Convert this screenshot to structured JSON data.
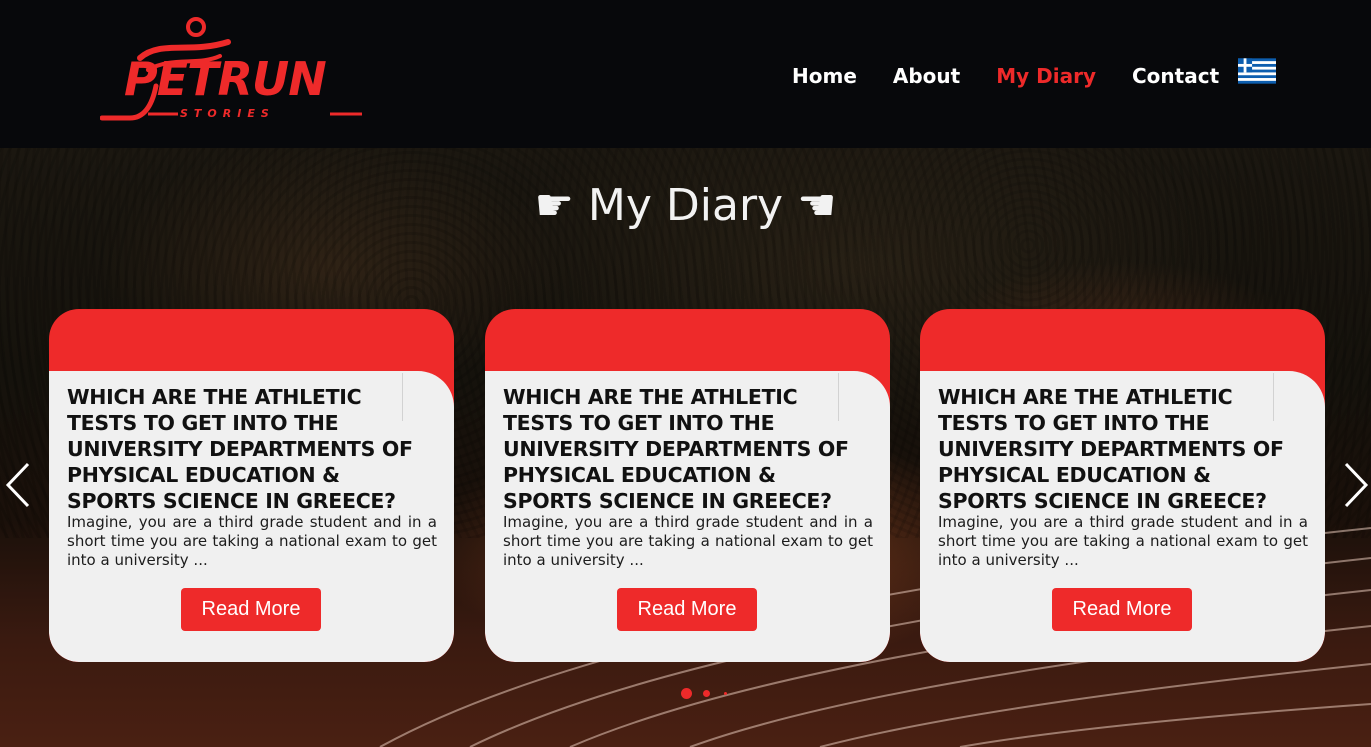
{
  "brand": {
    "name": "PETRUN",
    "tagline": "STORIES"
  },
  "nav": {
    "items": [
      {
        "label": "Home",
        "active": false
      },
      {
        "label": "About",
        "active": false
      },
      {
        "label": "My Diary",
        "active": true
      },
      {
        "label": "Contact",
        "active": false
      }
    ],
    "language_flag": "greek-flag-icon"
  },
  "hero": {
    "title": "☛ My Diary ☚"
  },
  "cards": [
    {
      "title": "WHICH ARE THE ATHLETIC TESTS TO GET INTO THE UNIVERSITY DEPARTMENTS OF PHYSICAL EDUCATION & SPORTS SCIENCE IN GREECE?",
      "excerpt": "Imagine, you are a third grade student and in a short time you are taking a national exam to get into a university ...",
      "button": "Read More"
    },
    {
      "title": "WHICH ARE THE ATHLETIC TESTS TO GET INTO THE UNIVERSITY DEPARTMENTS OF PHYSICAL EDUCATION & SPORTS SCIENCE IN GREECE?",
      "excerpt": "Imagine, you are a third grade student and in a short time you are taking a national exam to get into a university ...",
      "button": "Read More"
    },
    {
      "title": "WHICH ARE THE ATHLETIC TESTS TO GET INTO THE UNIVERSITY DEPARTMENTS OF PHYSICAL EDUCATION & SPORTS SCIENCE IN GREECE?",
      "excerpt": "Imagine, you are a third grade student and in a short time you are taking a national exam to get into a university ...",
      "button": "Read More"
    }
  ],
  "carousel": {
    "prev_icon": "chevron-left-icon",
    "next_icon": "chevron-right-icon",
    "dots": 3,
    "active_dot": 0
  },
  "colors": {
    "accent": "#ee2a2a",
    "header_bg": "#07080b",
    "card_bg": "#f0f0f0",
    "text_light": "#ffffff"
  }
}
